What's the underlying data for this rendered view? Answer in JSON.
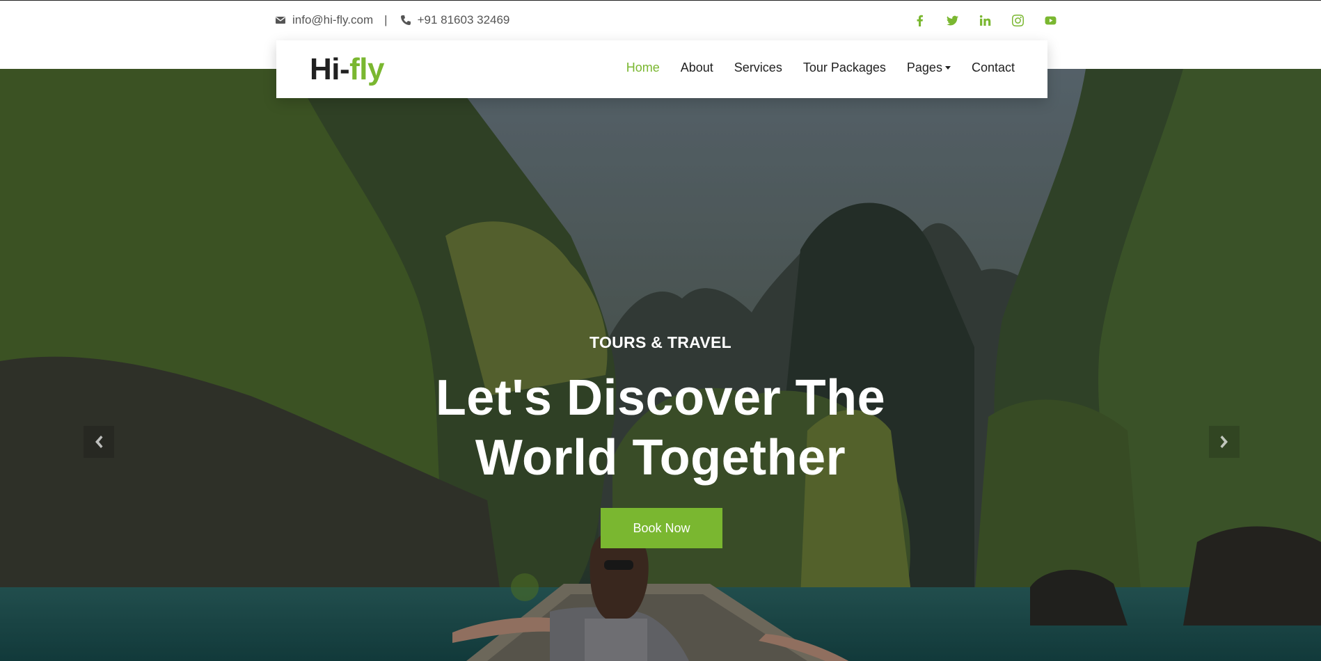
{
  "topbar": {
    "email": "info@hi-fly.com",
    "separator": "|",
    "phone": "+91 81603 32469",
    "icons": [
      "envelope-icon",
      "phone-icon"
    ],
    "socials": [
      "facebook-icon",
      "twitter-icon",
      "linkedin-icon",
      "instagram-icon",
      "youtube-icon"
    ]
  },
  "brand": {
    "prefix": "Hi-",
    "accent": "fly"
  },
  "nav": {
    "items": [
      "Home",
      "About",
      "Services",
      "Tour Packages",
      "Pages",
      "Contact"
    ],
    "active": "Home"
  },
  "hero": {
    "kicker": "TOURS & TRAVEL",
    "headline_line1": "Let's Discover The",
    "headline_line2": "World Together",
    "cta": "Book Now"
  },
  "colors": {
    "accent": "#7ab730",
    "text": "#212121",
    "white": "#ffffff"
  }
}
